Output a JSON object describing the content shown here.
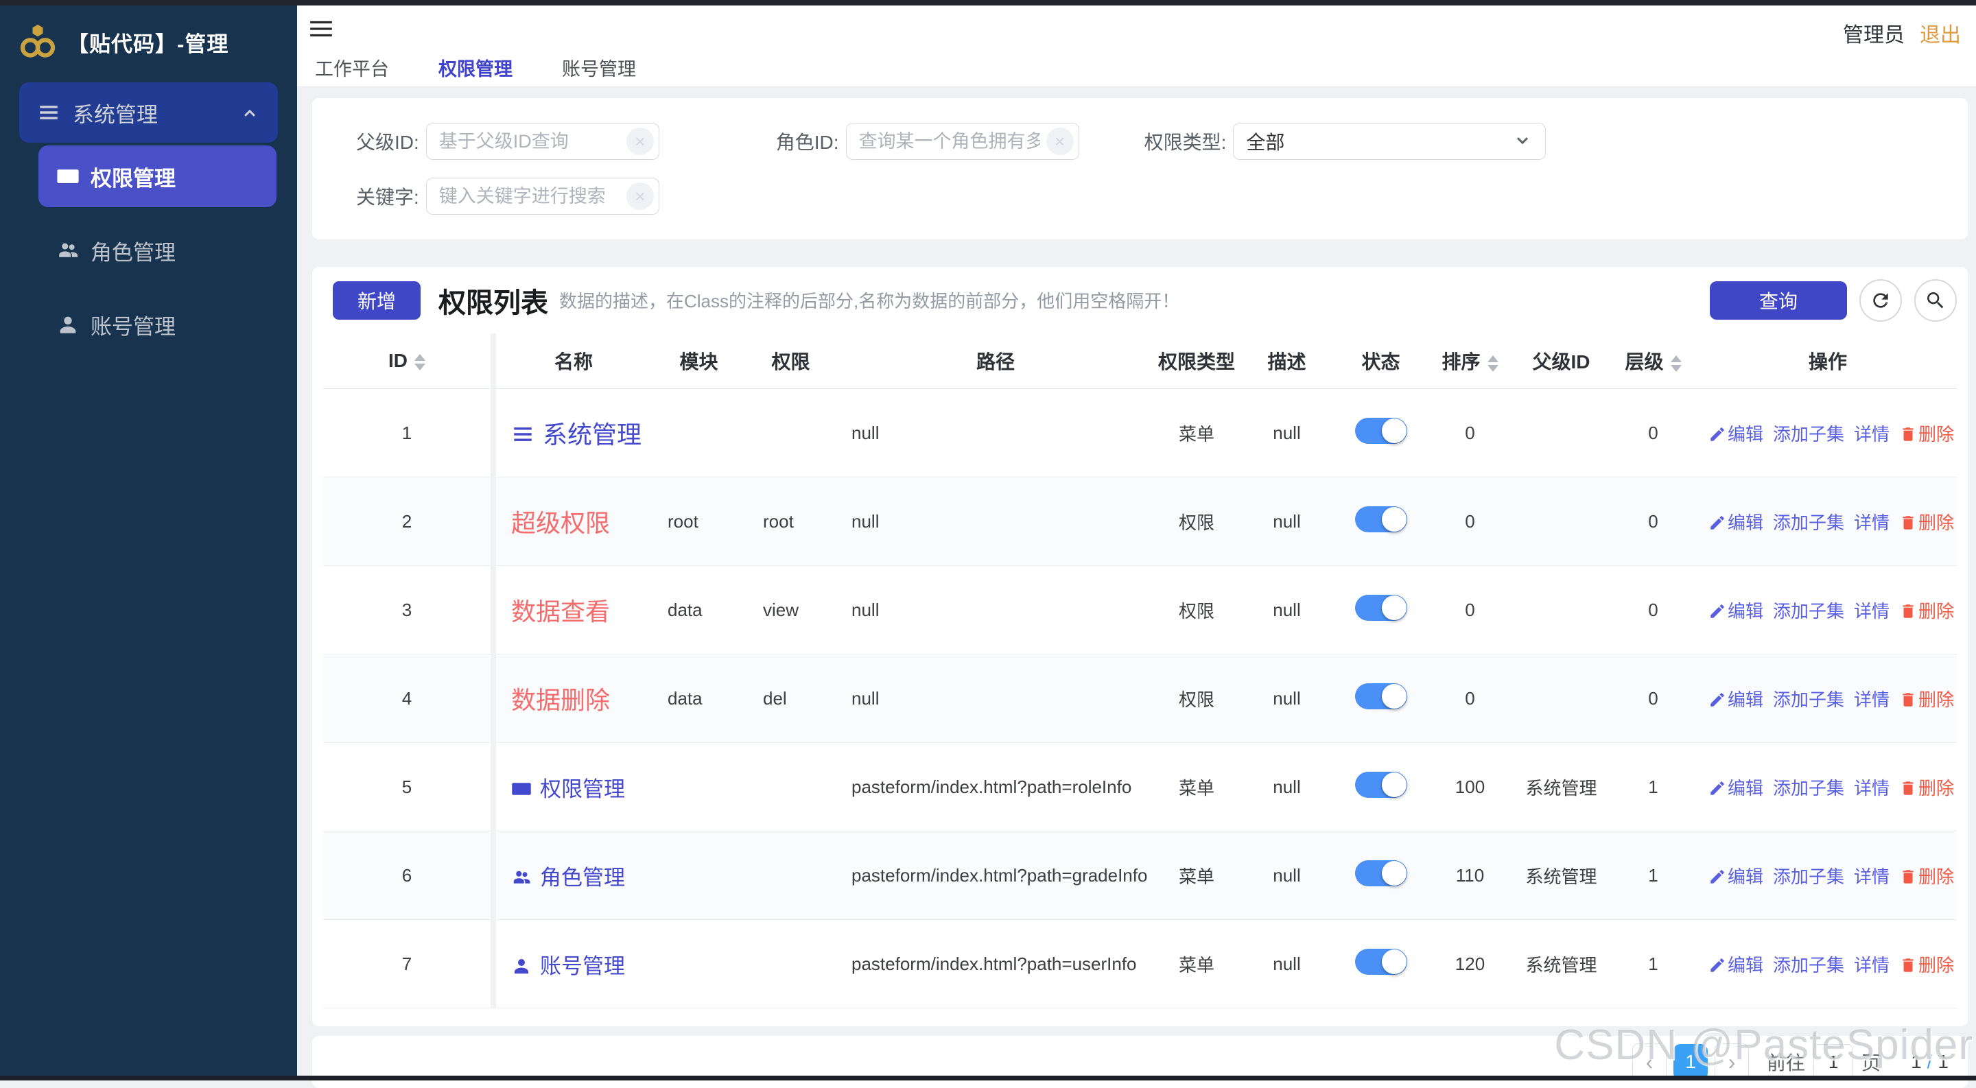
{
  "app": {
    "title": "【贴代码】-管理"
  },
  "header": {
    "user": "管理员",
    "logout": "退出",
    "tabs": [
      {
        "label": "工作平台",
        "active": false
      },
      {
        "label": "权限管理",
        "active": true
      },
      {
        "label": "账号管理",
        "active": false
      }
    ]
  },
  "sidebar": {
    "group": {
      "label": "系统管理"
    },
    "items": [
      {
        "label": "权限管理",
        "icon": "idcard",
        "active": true
      },
      {
        "label": "角色管理",
        "icon": "users",
        "active": false
      },
      {
        "label": "账号管理",
        "icon": "user",
        "active": false
      }
    ]
  },
  "filters": {
    "parent_id": {
      "label": "父级ID:",
      "placeholder": "基于父级ID查询"
    },
    "role_id": {
      "label": "角色ID:",
      "placeholder": "查询某一个角色拥有多少权限"
    },
    "perm_type": {
      "label": "权限类型:",
      "value": "全部"
    },
    "keyword": {
      "label": "关键字:",
      "placeholder": "键入关键字进行搜索"
    }
  },
  "toolbar": {
    "add_label": "新增",
    "title": "权限列表",
    "subtitle": "数据的描述，在Class的注释的后部分,名称为数据的前部分，他们用空格隔开！",
    "query_label": "查询"
  },
  "table": {
    "columns": [
      "ID",
      "名称",
      "模块",
      "权限",
      "路径",
      "权限类型",
      "描述",
      "状态",
      "排序",
      "父级ID",
      "层级",
      "操作"
    ],
    "actions": {
      "edit": "编辑",
      "add_child": "添加子集",
      "detail": "详情",
      "delete": "删除"
    },
    "rows": [
      {
        "id": 1,
        "name": "系统管理",
        "name_color": "blue",
        "name_icon": "menu",
        "module": "",
        "perm": "",
        "path": "null",
        "type": "菜单",
        "desc": "null",
        "status": true,
        "sort": 0,
        "parent": "",
        "level": 0
      },
      {
        "id": 2,
        "name": "超级权限",
        "name_color": "red",
        "name_icon": "",
        "module": "root",
        "perm": "root",
        "path": "null",
        "type": "权限",
        "desc": "null",
        "status": true,
        "sort": 0,
        "parent": "",
        "level": 0
      },
      {
        "id": 3,
        "name": "数据查看",
        "name_color": "red",
        "name_icon": "",
        "module": "data",
        "perm": "view",
        "path": "null",
        "type": "权限",
        "desc": "null",
        "status": true,
        "sort": 0,
        "parent": "",
        "level": 0
      },
      {
        "id": 4,
        "name": "数据删除",
        "name_color": "red",
        "name_icon": "",
        "module": "data",
        "perm": "del",
        "path": "null",
        "type": "权限",
        "desc": "null",
        "status": true,
        "sort": 0,
        "parent": "",
        "level": 0
      },
      {
        "id": 5,
        "name": "权限管理",
        "name_color": "blue",
        "name_icon": "idcard",
        "module": "",
        "perm": "",
        "path": "pasteform/index.html?path=roleInfo",
        "type": "菜单",
        "desc": "null",
        "status": true,
        "sort": 100,
        "parent": "系统管理",
        "level": 1
      },
      {
        "id": 6,
        "name": "角色管理",
        "name_color": "blue",
        "name_icon": "users",
        "module": "",
        "perm": "",
        "path": "pasteform/index.html?path=gradeInfo",
        "type": "菜单",
        "desc": "null",
        "status": true,
        "sort": 110,
        "parent": "系统管理",
        "level": 1
      },
      {
        "id": 7,
        "name": "账号管理",
        "name_color": "blue",
        "name_icon": "user",
        "module": "",
        "perm": "",
        "path": "pasteform/index.html?path=userInfo",
        "type": "菜单",
        "desc": "null",
        "status": true,
        "sort": 120,
        "parent": "系统管理",
        "level": 1
      }
    ]
  },
  "pagination": {
    "prev": "‹",
    "page": "1",
    "next": "›",
    "goto_label": "前往",
    "goto_value": "1",
    "page_unit": "页",
    "total_current": "1",
    "total_sep": "/",
    "total_pages": "1"
  },
  "watermark": "CSDN @PasteSpider",
  "colors": {
    "accent": "#3f47c6",
    "sidebar_bg": "#17334e",
    "group_bg": "#213c92",
    "active_item": "#4a51c8",
    "danger_name": "#f56c6c",
    "link": "#595fe0",
    "delete_link": "#f25a45",
    "toggle_on": "#4a90f6",
    "pager_active": "#3ba1f6",
    "logout": "#e09a3e",
    "logo_gold": "#c9a33f"
  }
}
